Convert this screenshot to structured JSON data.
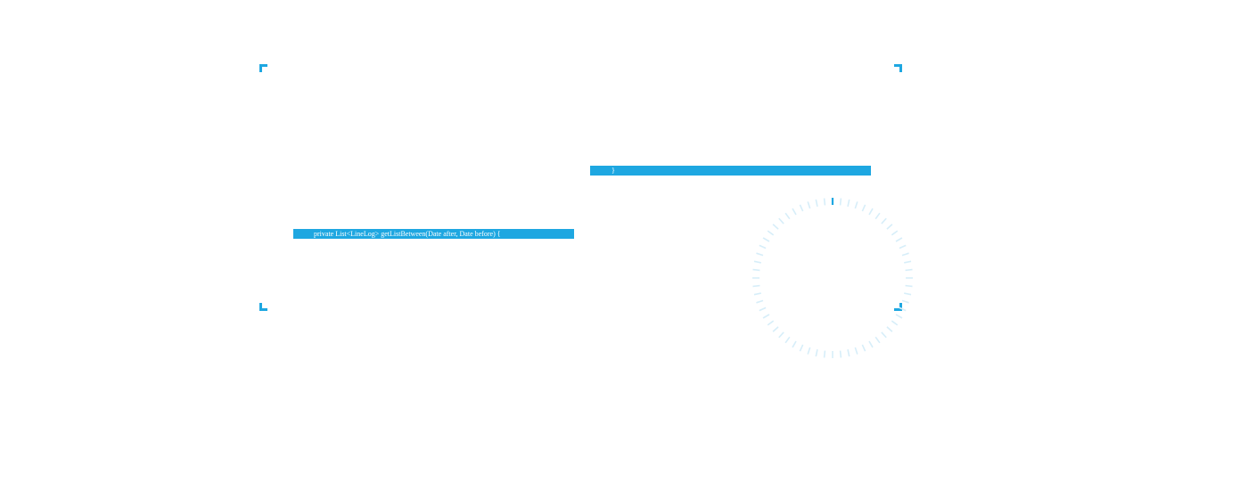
{
  "theme": {
    "accent": "#1ea7e1",
    "spinner_tick": "#d7eef9",
    "spinner_tick_active": "#1ea7e1"
  },
  "code_selection": {
    "line_closing_brace": "}",
    "line_method_signature": "private List<LineLog> getListBetween(Date after, Date before) {"
  },
  "spinner": {
    "icon": "loading-spinner-icon"
  }
}
